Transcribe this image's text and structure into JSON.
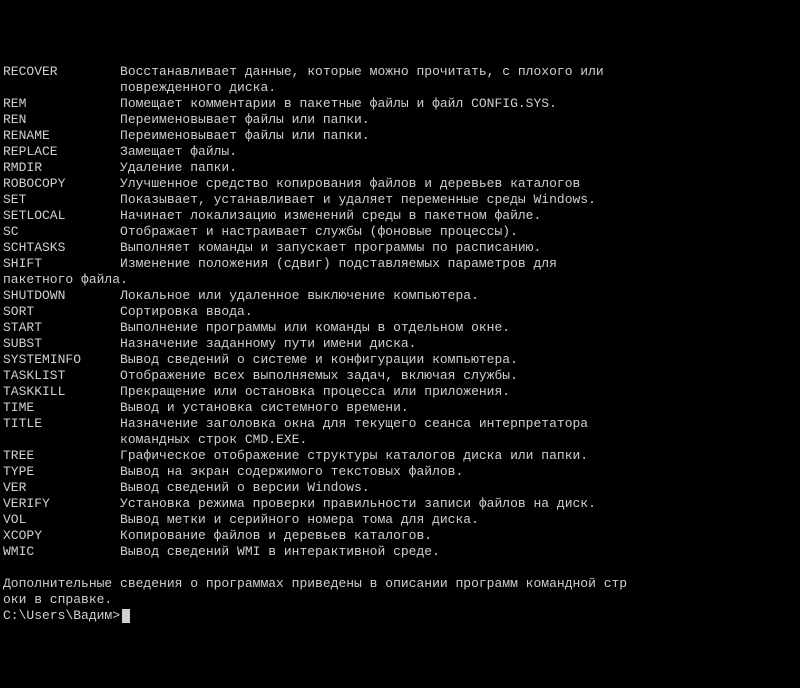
{
  "commands": [
    {
      "name": "RECOVER",
      "desc": "Восстанавливает данные, которые можно прочитать, с плохого или\n               поврежденного диска."
    },
    {
      "name": "REM",
      "desc": "Помещает комментарии в пакетные файлы и файл CONFIG.SYS."
    },
    {
      "name": "REN",
      "desc": "Переименовывает файлы или папки."
    },
    {
      "name": "RENAME",
      "desc": "Переименовывает файлы или папки."
    },
    {
      "name": "REPLACE",
      "desc": "Замещает файлы."
    },
    {
      "name": "RMDIR",
      "desc": "Удаление папки."
    },
    {
      "name": "ROBOCOPY",
      "desc": "Улучшенное средство копирования файлов и деревьев каталогов"
    },
    {
      "name": "SET",
      "desc": "Показывает, устанавливает и удаляет переменные среды Windows."
    },
    {
      "name": "SETLOCAL",
      "desc": "Начинает локализацию изменений среды в пакетном файле."
    },
    {
      "name": "SC",
      "desc": "Отображает и настраивает службы (фоновые процессы)."
    },
    {
      "name": "SCHTASKS",
      "desc": "Выполняет команды и запускает программы по расписанию."
    },
    {
      "name": "SHIFT",
      "desc": "Изменение положения (сдвиг) подставляемых параметров для\nпакетного файла."
    },
    {
      "name": "SHUTDOWN",
      "desc": "Локальное или удаленное выключение компьютера."
    },
    {
      "name": "SORT",
      "desc": "Сортировка ввода."
    },
    {
      "name": "START",
      "desc": "Выполнение программы или команды в отдельном окне."
    },
    {
      "name": "SUBST",
      "desc": "Назначение заданному пути имени диска."
    },
    {
      "name": "SYSTEMINFO",
      "desc": "Вывод сведений о системе и конфигурации компьютера."
    },
    {
      "name": "TASKLIST",
      "desc": "Отображение всех выполняемых задач, включая службы."
    },
    {
      "name": "TASKKILL",
      "desc": "Прекращение или остановка процесса или приложения."
    },
    {
      "name": "TIME",
      "desc": "Вывод и установка системного времени."
    },
    {
      "name": "TITLE",
      "desc": "Назначение заголовка окна для текущего сеанса интерпретатора\n               командных строк CMD.EXE."
    },
    {
      "name": "TREE",
      "desc": "Графическое отображение структуры каталогов диска или папки.\n"
    },
    {
      "name": "TYPE",
      "desc": "Вывод на экран содержимого текстовых файлов."
    },
    {
      "name": "VER",
      "desc": "Вывод сведений о версии Windows."
    },
    {
      "name": "VERIFY",
      "desc": "Установка режима проверки правильности записи файлов на диск.\n"
    },
    {
      "name": "VOL",
      "desc": "Вывод метки и серийного номера тома для диска."
    },
    {
      "name": "XCOPY",
      "desc": "Копирование файлов и деревьев каталогов."
    },
    {
      "name": "WMIC",
      "desc": "Вывод сведений WMI в интерактивной среде."
    }
  ],
  "footer": "\nДополнительные сведения о программах приведены в описании программ командной стр\nоки в справке.\n",
  "prompt": "C:\\Users\\Вадим>"
}
